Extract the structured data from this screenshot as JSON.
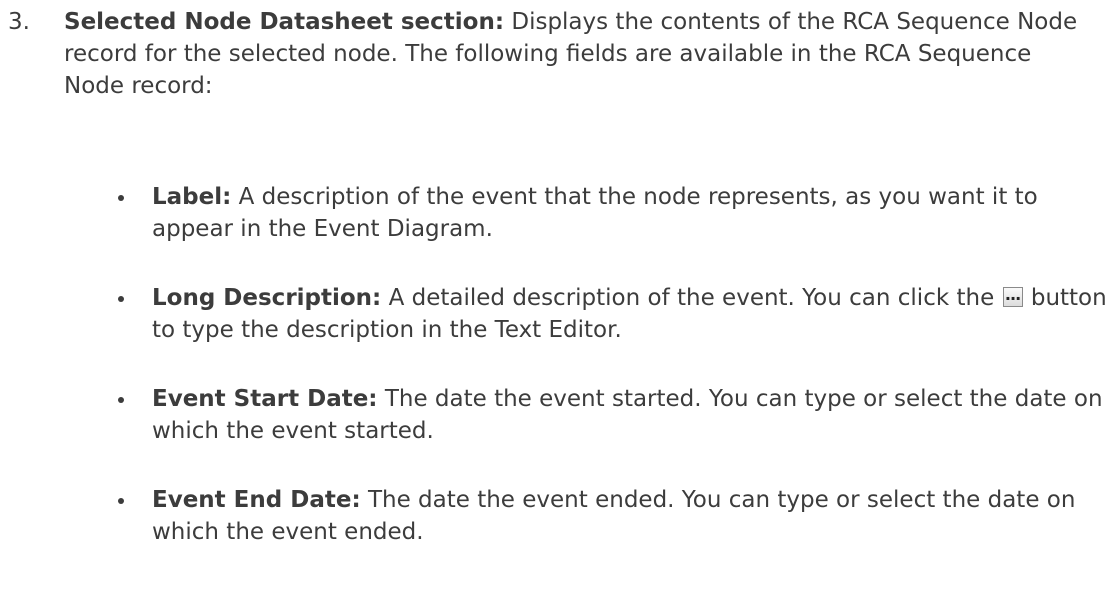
{
  "item3": {
    "number": "3.",
    "title": "Selected Node Datasheet section:",
    "text": " Displays the contents of the RCA Sequence Node record for the selected node. The following fields are available in the RCA Sequence Node record:"
  },
  "fields": [
    {
      "term": "Label:",
      "text": " A description of the event that the node represents, as you want it to appear in the Event Diagram."
    },
    {
      "term": "Long Description:",
      "text_before": " A detailed description of the event. You can click the ",
      "button_label": "...",
      "text_after": " button to type the description in the Text Editor."
    },
    {
      "term": "Event Start Date:",
      "text": " The date the event started. You can type or select the date on which the event started."
    },
    {
      "term": "Event End Date:",
      "text": " The date the event ended. You can type or select the date on which the event ended."
    }
  ]
}
